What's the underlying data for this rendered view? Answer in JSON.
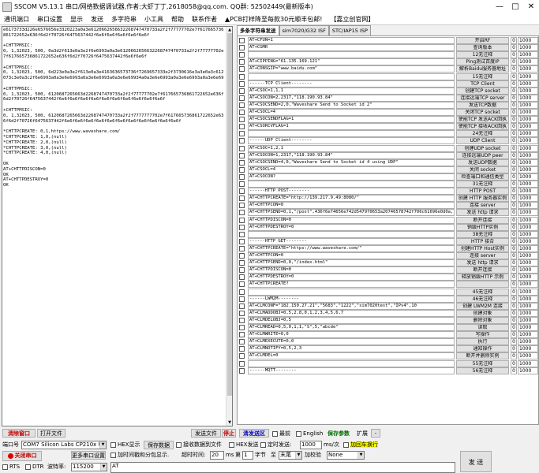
{
  "title": "SSCOM V5.13.1 串口/网络数据调试器,作者:大虾丁丁,2618058@qq.com. QQ群: 52502449(最新版本)",
  "menu": [
    "通讯端口",
    "串口设置",
    "显示",
    "发送",
    "多字符串",
    "小工具",
    "帮助",
    "联系作者",
    "▲PCB打样降至每款30元顺丰包邮!",
    "【嘉立创官网】"
  ],
  "receive_text": "e6173733d226e6576656e3320223a0a3e6120662656632268747470733a2f2f77777702e7f617665736861722652e636f6d2f70726f6475637442f6e6f6e6f6e6f6e6f6e6f\n\n+CHTTPMSIC:\n0, 1,32023, 500, 0a3d2f613e0a3e2f6e6993a0a3e6120662656632268747470733a2f2f77777702e7f617665736861722652e636f6d2f70726f6475637442f6e6f6e6f\n\n+CHTTPMSIC:\n0, 1,32023, 500, 6d223e0a3e2f613e0a3e4163636573736f7269657333e2f3730616e3a3e0a3c612073c3e0a3c2f6e6993a0a3e6e6993a0a3e6e6993a0a3e6e69934a0a3e6e6993a0a3e6e6993a0a3e6e69\n\n+CHTTPMSIC:\n0, 1,32023, 500, 6120687265663d2268747470733a2f2f77777702e7f617665736861722652e636f6d2f70726f6475637442f6e6f6e6f6e6f6e6f6e6f6e6f6e6f6e6f6e6f6e6f\n\n+CHTTPMSIC:\n0, 1,32023, 500, 6120687265663d2268747470733a2f2f7777777702e7f617665736861722652e636f6d2f70726f6475637442f6e6f6e6f6e6f6e6f6e6f6e6f6e6f6e6f6e6f6e6f6e6f\n\n*CHTTPCREATE: 0,1,https://www.waveshare.com/\n*CHTTPCREATE: 1,0,(null)\n*CHTTPCREATE: 2,0,(null)\n*CHTTPCREATE: 3,0,(null)\n*CHTTPCREATE: 4,0,(null)\n\nOK\nAT+CHTTPDISCON=0\nOK\nAT+CHTTPDESTROY=0\nOK",
  "tabs": [
    "多条字符串发送",
    "sim7020/G32 ISF",
    "STC/IAP15 ISP"
  ],
  "commands": [
    {
      "cmd": "AT+CFUN=1",
      "label": "开启RF",
      "n1": "0",
      "n2": "1000"
    },
    {
      "cmd": "AT+CGMR",
      "label": "查询版本",
      "n1": "0",
      "n2": "1000"
    },
    {
      "cmd": "",
      "label": "12无注释",
      "n1": "0",
      "n2": "1000"
    },
    {
      "cmd": "AT+CIPPING=\"61.135.169.121\"",
      "label": "Ping测试百度IP",
      "n1": "0",
      "n2": "1000"
    },
    {
      "cmd": "AT+CDNSGIP=\"www.baidu.com\"",
      "label": "解析Baidu服务器地址",
      "n1": "0",
      "n2": "1000"
    },
    {
      "cmd": "",
      "label": "15无注释",
      "n1": "0",
      "n2": "1000"
    },
    {
      "cmd": "------TCP Client--------",
      "label": "TCP Client",
      "n1": "0",
      "n2": "1000"
    },
    {
      "cmd": "AT+CSOC=1,1,1",
      "label": "创建TCP socket",
      "n1": "0",
      "n2": "1000"
    },
    {
      "cmd": "AT+CSOCON=2,2317,\"118.190.93.84\"",
      "label": "连接远端TCP server",
      "n1": "0",
      "n2": "1000"
    },
    {
      "cmd": "AT+CSOCSEND=2,0,\"Waveshare Send to Socket id 2\"",
      "label": "发送TCP数据",
      "n1": "0",
      "n2": "1000"
    },
    {
      "cmd": "AT+CSOCL=4",
      "label": "关闭TCP socket",
      "n1": "0",
      "n2": "1000"
    },
    {
      "cmd": "AT+CSOCSENDFLAG=1",
      "label": "使能TCP 发送ACK回执",
      "n1": "0",
      "n2": "1000"
    },
    {
      "cmd": "AT+CSORCVFLAG=1",
      "label": "使能TCP 接收ACK回执",
      "n1": "0",
      "n2": "1000"
    },
    {
      "cmd": "",
      "label": "24无注释",
      "n1": "0",
      "n2": "1000"
    },
    {
      "cmd": "------UDP Client--------",
      "label": "UDP Client",
      "n1": "0",
      "n2": "1000"
    },
    {
      "cmd": "AT+CSOC=1,2,1",
      "label": "创建UDP socket",
      "n1": "0",
      "n2": "1000"
    },
    {
      "cmd": "AT+CSOCON=1,2317,\"118.190.93.84\"",
      "label": "连接远端UDP peer",
      "n1": "0",
      "n2": "1000"
    },
    {
      "cmd": "AT+CSOCSEND=4,0,\"Waveshare Send to Socket id 4 using UDP\"",
      "label": "发送UDP数据",
      "n1": "0",
      "n2": "1000"
    },
    {
      "cmd": "AT+CSOCL=4",
      "label": "关闭 socket",
      "n1": "0",
      "n2": "1000"
    },
    {
      "cmd": "AT+CSOCON?",
      "label": "检查端口和通信类型",
      "n1": "0",
      "n2": "1000"
    },
    {
      "cmd": "",
      "label": "31无注释",
      "n1": "0",
      "n2": "1000"
    },
    {
      "cmd": "------HTTP POST--------",
      "label": "HTTP POST",
      "n1": "0",
      "n2": "1000"
    },
    {
      "cmd": "AT+CHTTPCREATE=\"http://139.217.9.49:8080/\"",
      "label": "创建 HTTP 服务器实例",
      "n1": "0",
      "n2": "1000"
    },
    {
      "cmd": "AT+CHTTPCON=0",
      "label": "连接 server",
      "n1": "0",
      "n2": "1000"
    },
    {
      "cmd": "AT+CHTTPSEND=0,1,\"/post\",436f6e74656e742d547970653a20746578742f706c61696e0d0a,\"text/plain\",74657374",
      "label": "发送 http 请求",
      "n1": "0",
      "n2": "1000"
    },
    {
      "cmd": "AT+CHTTPDISCON=0",
      "label": "断开连接",
      "n1": "0",
      "n2": "1000"
    },
    {
      "cmd": "AT+CHTTPDESTROY=0",
      "label": "销毁HTTP实例",
      "n1": "0",
      "n2": "1000"
    },
    {
      "cmd": "",
      "label": "38无注释",
      "n1": "0",
      "n2": "1000"
    },
    {
      "cmd": "------HTTP GET--------",
      "label": "HTTP 接合",
      "n1": "0",
      "n2": "1000"
    },
    {
      "cmd": "AT+CHTTPCREATE=\"https://www.waveshare.com/\"",
      "label": "创建HTTP Host实例",
      "n1": "0",
      "n2": "1000"
    },
    {
      "cmd": "AT+CHTTPCON=0",
      "label": "连接 server",
      "n1": "0",
      "n2": "1000"
    },
    {
      "cmd": "AT+CHTTPSEND=0,0,\"/index.html\"",
      "label": "发送 http 请求",
      "n1": "0",
      "n2": "1000"
    },
    {
      "cmd": "AT+CHTTPDISCON=0",
      "label": "断开连接",
      "n1": "0",
      "n2": "1000"
    },
    {
      "cmd": "AT+CHTTPDESTROY=0",
      "label": "释放销毁HTTP 示例",
      "n1": "0",
      "n2": "1000"
    },
    {
      "cmd": "AT+CHTTPCREATE?",
      "label": "",
      "n1": "0",
      "n2": "1000"
    },
    {
      "cmd": "",
      "label": "45无注释",
      "n1": "0",
      "n2": "1000"
    },
    {
      "cmd": "------LWM2M--------",
      "label": "46无注释",
      "n1": "0",
      "n2": "1000"
    },
    {
      "cmd": "AT+CLMCONF=\"182.150.27.21\",\"5683\",\"1222\",\"sim7020test\",\"IPv4\",10",
      "label": "创建 LWM2M 连接",
      "n1": "0",
      "n2": "1000"
    },
    {
      "cmd": "AT+CLMADDOBJ=0,5,2,8,0,1,2,3,4,5,6,7",
      "label": "创建对象",
      "n1": "0",
      "n2": "1000"
    },
    {
      "cmd": "AT+CLMDELOBJ=0,5",
      "label": "删除对象",
      "n1": "0",
      "n2": "1000"
    },
    {
      "cmd": "AT+CLMREAD=0,5,0,1,1,\"S\",5,\"abcde\"",
      "label": "读取",
      "n1": "0",
      "n2": "1000"
    },
    {
      "cmd": "AT+CLMWRITE=0,0",
      "label": "写操作",
      "n1": "0",
      "n2": "1000"
    },
    {
      "cmd": "AT+CLMEXECUTE=0,0",
      "label": "执行",
      "n1": "0",
      "n2": "1000"
    },
    {
      "cmd": "AT+CLMNOTIFY=0,5,2,3",
      "label": "通知操作",
      "n1": "0",
      "n2": "1000"
    },
    {
      "cmd": "AT+CLMDEL=0",
      "label": "断开并删除实例",
      "n1": "0",
      "n2": "1000"
    },
    {
      "cmd": "",
      "label": "55无注释",
      "n1": "0",
      "n2": "1000"
    },
    {
      "cmd": "------MQTT--------",
      "label": "56无注释",
      "n1": "0",
      "n2": "1000"
    }
  ],
  "bottom": {
    "clear_window": "清除窗口",
    "open_file": "打开文件",
    "send_file": "发送文件",
    "stop": "停止",
    "clear_send": "清发送区",
    "topmost": "最前",
    "english": "English",
    "save_params": "保存参数",
    "expand": "扩展",
    "expand_arrow": "-",
    "port_label": "端口号",
    "port_value": "COM7 Silicon Labs CP210x U",
    "hex_display": "HEX显示",
    "save_data": "保存数据",
    "recv_to_file": "接收数据到文件",
    "hex_send": "HEX发送",
    "timed_send": "定时发送:",
    "interval": "1000",
    "interval_unit": "ms/次",
    "add_crlf": "加回车换行",
    "close_port": "关闭串口",
    "more_settings": "更多串口设置",
    "add_timestamp": "加时间戳和分包显示.",
    "timeout": "超时时间:",
    "timeout_value": "20",
    "timeout_unit": "ms",
    "byte_no": "第",
    "byte_value": "1",
    "byte_unit": "字节",
    "to": "至",
    "end": "末尾",
    "checksum": "加校验",
    "checksum_value": "None",
    "rts": "RTS",
    "dtr": "DTR",
    "baud_label": "波特率:",
    "baud_value": "115200",
    "send_label": "发 送",
    "send_content": "AT"
  }
}
